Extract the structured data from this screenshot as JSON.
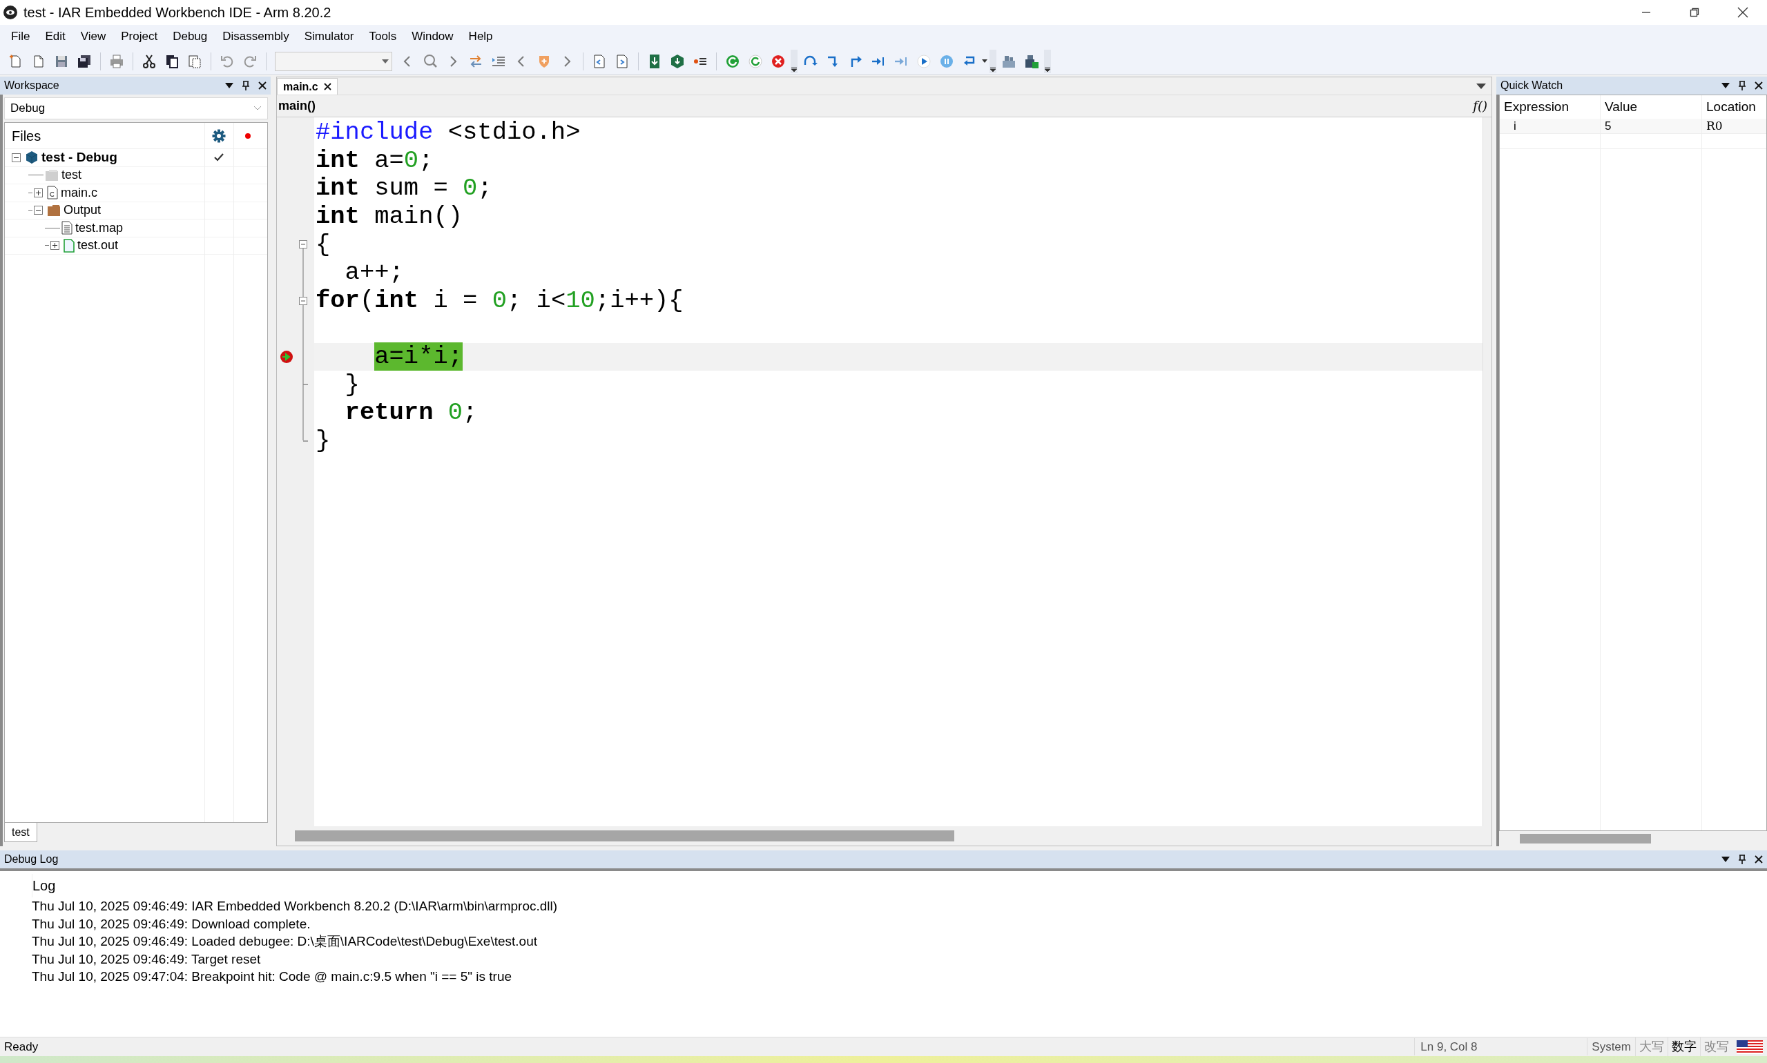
{
  "window": {
    "title": "test - IAR Embedded Workbench IDE - Arm 8.20.2"
  },
  "menu": [
    "File",
    "Edit",
    "View",
    "Project",
    "Debug",
    "Disassembly",
    "Simulator",
    "Tools",
    "Window",
    "Help"
  ],
  "workspace": {
    "title": "Workspace",
    "configuration": "Debug",
    "files_header": "Files",
    "tree": [
      {
        "label": "test - Debug",
        "kind": "project",
        "expanded": true,
        "checked": true,
        "children": [
          {
            "label": "test",
            "kind": "group",
            "checked": false
          },
          {
            "label": "main.c",
            "kind": "c-file",
            "expanded": false,
            "checked": false
          },
          {
            "label": "Output",
            "kind": "output",
            "expanded": true,
            "checked": false,
            "children": [
              {
                "label": "test.map",
                "kind": "map-file",
                "checked": false
              },
              {
                "label": "test.out",
                "kind": "out-file",
                "expanded": false,
                "checked": false
              }
            ]
          }
        ]
      }
    ],
    "tabs": [
      {
        "label": "test",
        "selected": true
      }
    ]
  },
  "editor": {
    "tabs": [
      {
        "label": "main.c",
        "selected": true
      }
    ],
    "scope": "main()",
    "function_button": "f()",
    "lines": [
      {
        "tokens": [
          {
            "text": "#include",
            "kind": "preproc"
          },
          {
            "text": " <stdio.h>",
            "kind": "plain"
          }
        ]
      },
      {
        "tokens": [
          {
            "text": "int",
            "kind": "keyword"
          },
          {
            "text": " a=",
            "kind": "plain"
          },
          {
            "text": "0",
            "kind": "number"
          },
          {
            "text": ";",
            "kind": "plain"
          }
        ]
      },
      {
        "tokens": [
          {
            "text": "int",
            "kind": "keyword"
          },
          {
            "text": " sum = ",
            "kind": "plain"
          },
          {
            "text": "0",
            "kind": "number"
          },
          {
            "text": ";",
            "kind": "plain"
          }
        ]
      },
      {
        "tokens": [
          {
            "text": "int",
            "kind": "keyword"
          },
          {
            "text": " main()",
            "kind": "plain"
          }
        ]
      },
      {
        "tokens": [
          {
            "text": "{",
            "kind": "plain"
          }
        ],
        "fold_start": true,
        "fold_end": false
      },
      {
        "tokens": [
          {
            "text": "  a++;",
            "kind": "plain"
          }
        ],
        "fold_start": false,
        "fold_end": false
      },
      {
        "tokens": [
          {
            "text": "for",
            "kind": "keyword"
          },
          {
            "text": "(",
            "kind": "plain"
          },
          {
            "text": "int",
            "kind": "keyword"
          },
          {
            "text": " i = ",
            "kind": "plain"
          },
          {
            "text": "0",
            "kind": "number"
          },
          {
            "text": "; i<",
            "kind": "plain"
          },
          {
            "text": "10",
            "kind": "number"
          },
          {
            "text": ";i++){",
            "kind": "plain"
          }
        ],
        "fold_start": true,
        "fold_end": false
      },
      {
        "fold_start": false,
        "fold_end": false
      },
      {
        "tokens": [
          {
            "text": "    a=i*i;",
            "kind": "current"
          }
        ],
        "fold_start": false,
        "fold_end": false,
        "breakpoint": true,
        "current": true
      },
      {
        "tokens": [
          {
            "text": "  }",
            "kind": "plain"
          }
        ],
        "fold_start": false,
        "fold_end": true
      },
      {
        "tokens": [
          {
            "text": "  return",
            "kind": "keyword"
          },
          {
            "text": " 0",
            "kind": "number"
          },
          {
            "text": ";",
            "kind": "plain"
          }
        ],
        "fold_start": false,
        "fold_end": false
      },
      {
        "tokens": [
          {
            "text": "}",
            "kind": "plain"
          }
        ],
        "fold_start": false,
        "fold_end": true
      }
    ]
  },
  "quick_watch": {
    "title": "Quick Watch",
    "columns": [
      "Expression",
      "Value",
      "Location"
    ],
    "rows": [
      [
        "i",
        "5",
        "R0"
      ]
    ]
  },
  "debug_log": {
    "title": "Debug Log",
    "header": "Log",
    "lines": [
      "Thu Jul 10, 2025 09:46:49: IAR Embedded Workbench 8.20.2 (D:\\IAR\\arm\\bin\\armproc.dll)",
      "Thu Jul 10, 2025 09:46:49: Download complete.",
      "Thu Jul 10, 2025 09:46:49: Loaded debugee: D:\\桌面\\IARCode\\test\\Debug\\Exe\\test.out",
      "Thu Jul 10, 2025 09:46:49: Target reset",
      "Thu Jul 10, 2025 09:47:04: Breakpoint hit: Code @ main.c:9.5 when \"i == 5\" is true"
    ]
  },
  "status_bar": {
    "message": "Ready",
    "position": "Ln 9, Col 8",
    "input": "System",
    "indicators": [
      {
        "label": "大写",
        "on": false
      },
      {
        "label": "数字",
        "on": true
      },
      {
        "label": "改写",
        "on": false
      }
    ]
  }
}
